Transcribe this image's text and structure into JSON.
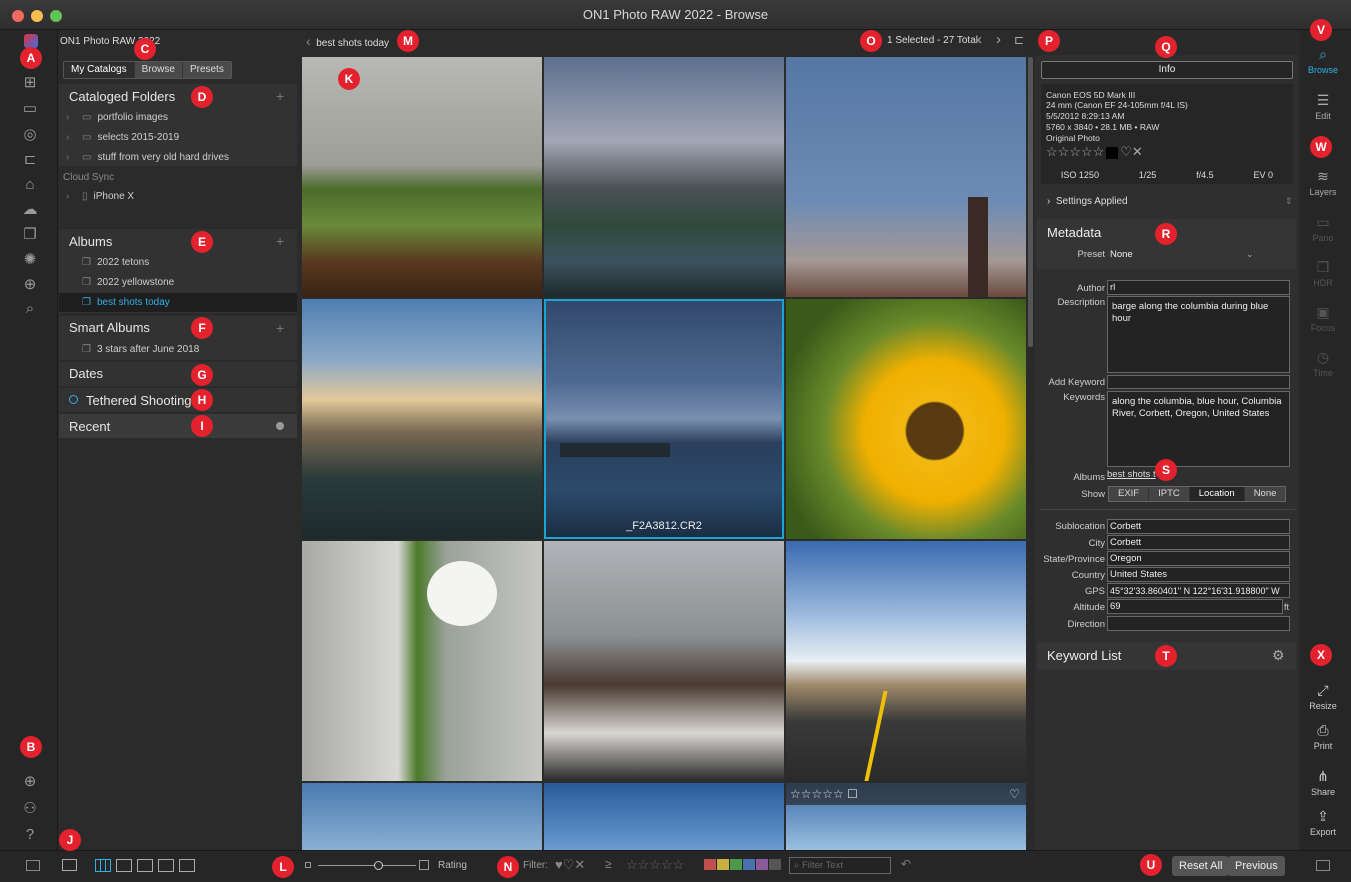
{
  "window": {
    "title": "ON1 Photo RAW 2022 - Browse"
  },
  "app": {
    "name": "ON1 Photo RAW 2022"
  },
  "left_tabs": [
    "My Catalogs",
    "Browse",
    "Presets"
  ],
  "cataloged_folders": {
    "title": "Cataloged Folders",
    "items": [
      "portfolio images",
      "selects 2015-2019",
      "stuff from very old hard drives"
    ]
  },
  "cloud_sync": {
    "title": "Cloud Sync",
    "device": "iPhone X"
  },
  "albums": {
    "title": "Albums",
    "items": [
      "2022 tetons",
      "2022 yellowstone",
      "best shots today"
    ]
  },
  "smart_albums": {
    "title": "Smart Albums",
    "items": [
      "3 stars after June 2018"
    ]
  },
  "dates": {
    "title": "Dates"
  },
  "tethered": {
    "title": "Tethered Shooting"
  },
  "recent": {
    "title": "Recent"
  },
  "breadcrumb": {
    "current": "best shots today"
  },
  "selection": {
    "status": "1 Selected - 27 Total"
  },
  "selected_file": "_F2A3812.CR2",
  "info": {
    "tab": "Info",
    "camera": "Canon EOS 5D Mark III",
    "lens": "24 mm (Canon EF 24-105mm f/4L IS)",
    "datetime": "5/5/2012 8:29:13 AM",
    "dims": "5760 x 3840 • 28.1 MB • RAW",
    "version": "Original Photo",
    "iso": "ISO 1250",
    "shutter": "1/25",
    "aperture": "f/4.5",
    "ev": "EV 0",
    "settings_applied": "Settings Applied"
  },
  "metadata": {
    "title": "Metadata",
    "preset_label": "Preset",
    "preset_value": "None",
    "author_label": "Author",
    "author": "rl",
    "description_label": "Description",
    "description": "barge along the columbia during blue hour",
    "add_keyword_label": "Add Keyword",
    "keywords_label": "Keywords",
    "keywords": "along the columbia, blue hour, Columbia River, Corbett, Oregon, United States",
    "albums_label": "Albums",
    "albums_value": "best shots t",
    "show_label": "Show",
    "show_options": [
      "EXIF",
      "IPTC",
      "Location",
      "None"
    ],
    "sublocation_label": "Sublocation",
    "sublocation": "Corbett",
    "city_label": "City",
    "city": "Corbett",
    "state_label": "State/Province",
    "state": "Oregon",
    "country_label": "Country",
    "country": "United States",
    "gps_label": "GPS",
    "gps": "45°32'33.860401\" N 122°16'31.918800\" W",
    "altitude_label": "Altitude",
    "altitude": "69",
    "altitude_unit": "ft",
    "direction_label": "Direction",
    "direction": ""
  },
  "keyword_list": {
    "title": "Keyword List"
  },
  "right_modules": [
    "Browse",
    "Edit",
    "Layers",
    "Pano",
    "HDR",
    "Focus",
    "Time"
  ],
  "right_tools": [
    "Resize",
    "Print",
    "Share",
    "Export"
  ],
  "bottom": {
    "rating_label": "Rating",
    "filter_label": "Filter:",
    "filter_placeholder": "Filter Text",
    "reset_all": "Reset All",
    "previous": "Previous",
    "color_labels": [
      "#c05050",
      "#c8b040",
      "#4a9a4a",
      "#4a70b0",
      "#8a5a9a",
      "#555555"
    ]
  },
  "badges": [
    "A",
    "B",
    "C",
    "D",
    "E",
    "F",
    "G",
    "H",
    "I",
    "J",
    "K",
    "L",
    "M",
    "N",
    "O",
    "P",
    "Q",
    "R",
    "S",
    "T",
    "U",
    "V",
    "W",
    "X"
  ]
}
